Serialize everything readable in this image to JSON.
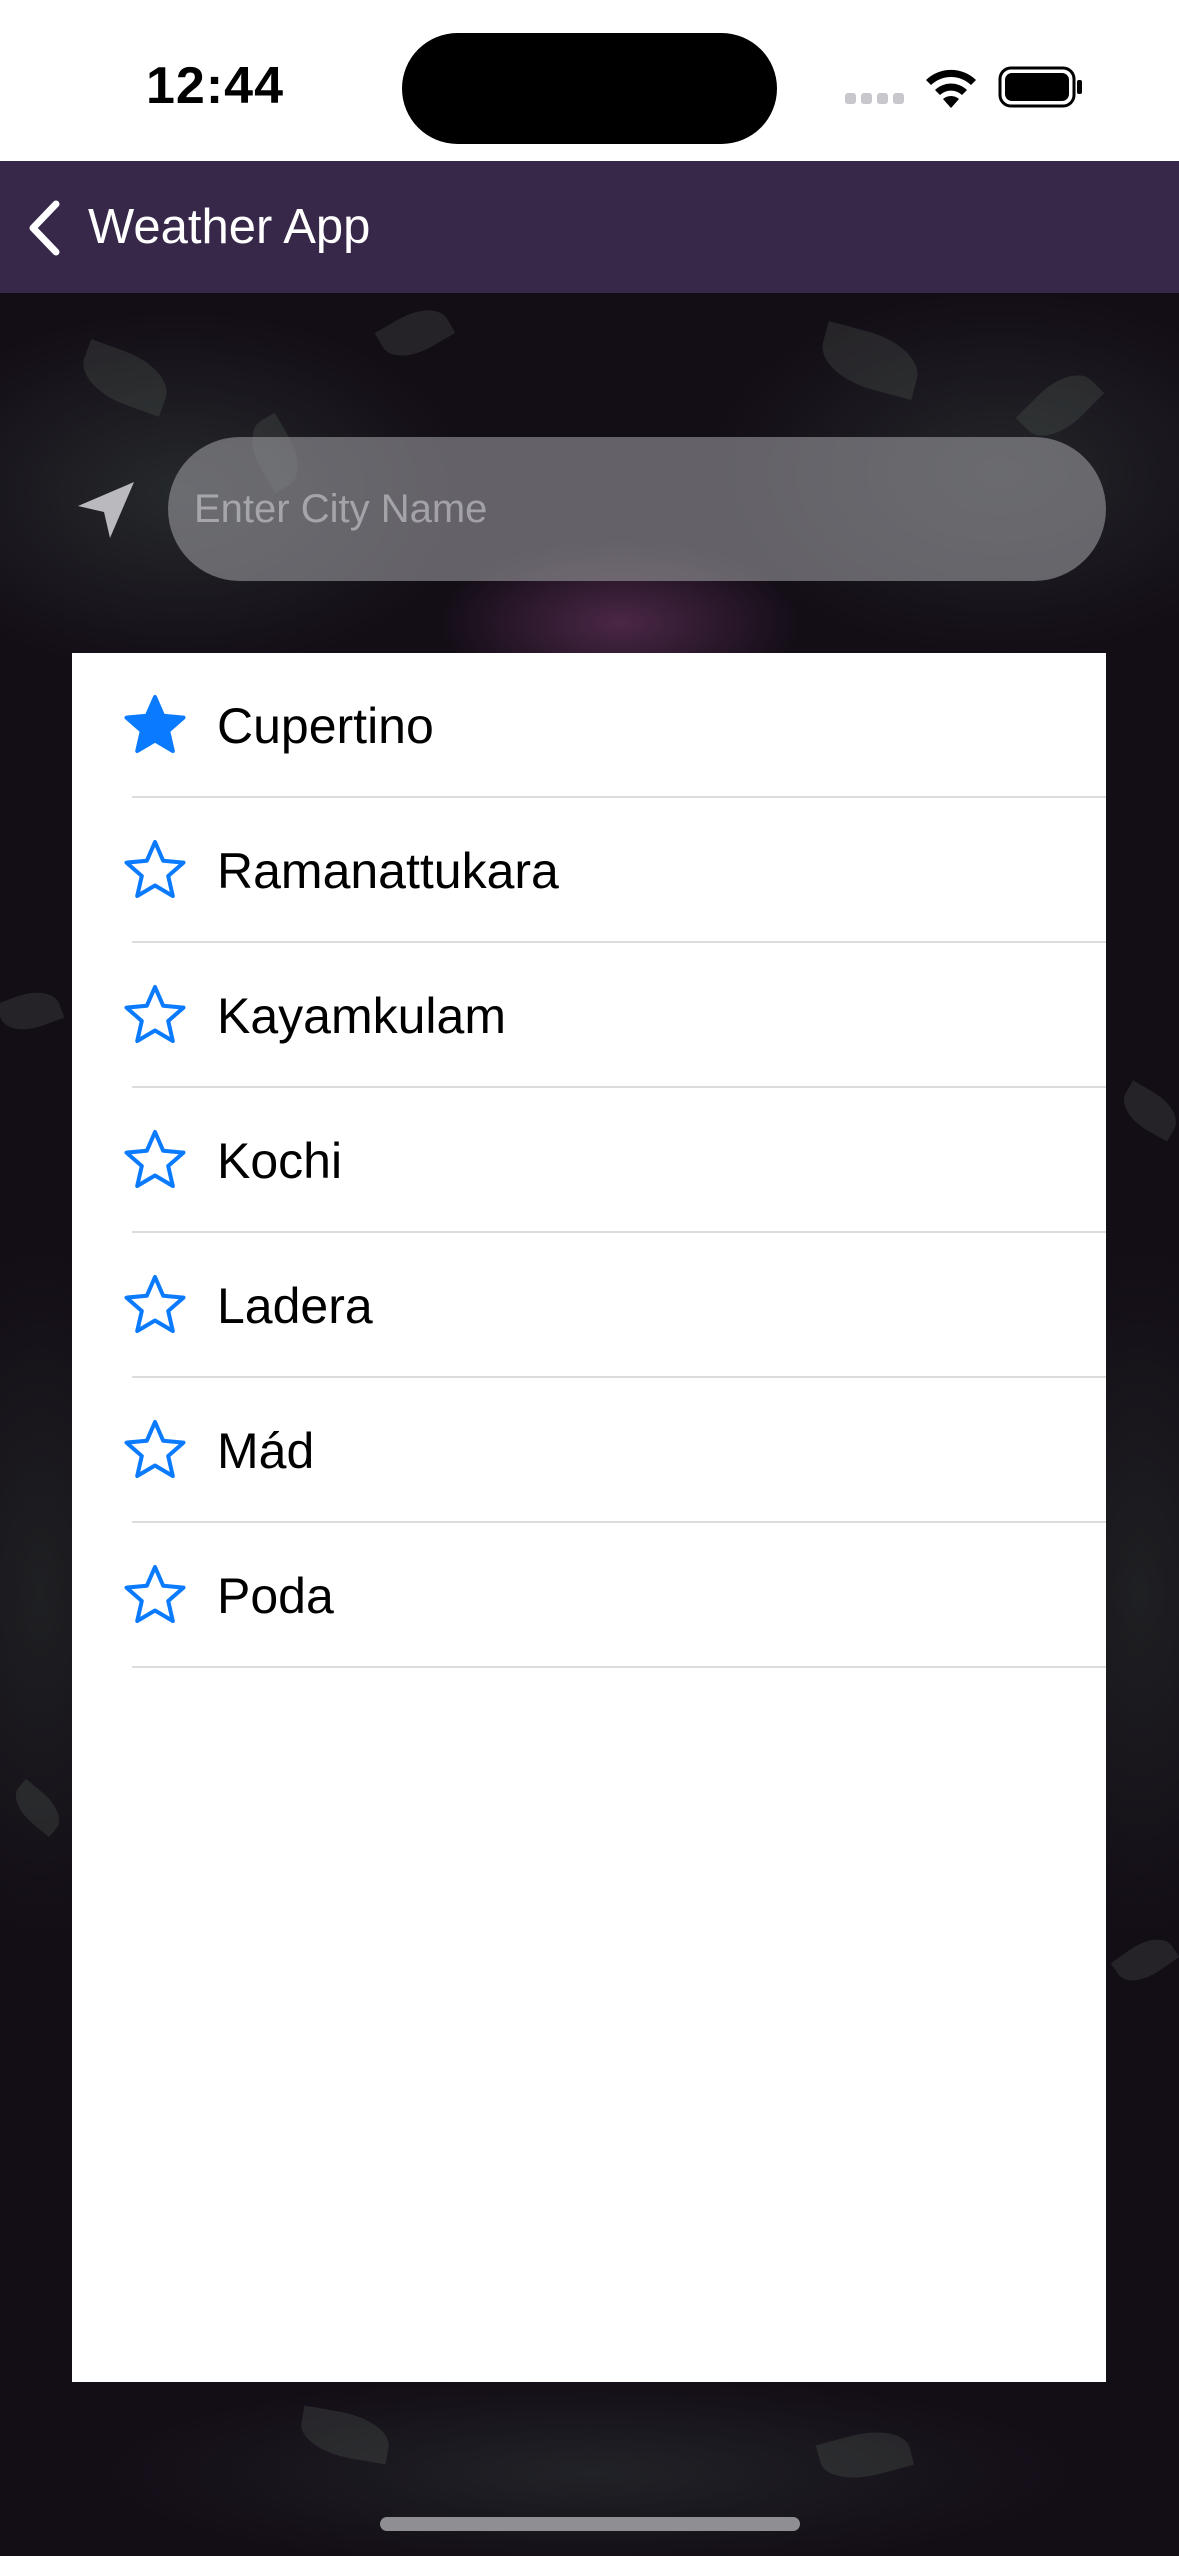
{
  "status_bar": {
    "time": "12:44",
    "icons": [
      "signal-icon",
      "wifi-icon",
      "battery-icon"
    ]
  },
  "nav": {
    "back_icon": "chevron-left-icon",
    "title": "Weather App"
  },
  "search": {
    "location_icon": "location-arrow-icon",
    "placeholder": "Enter City Name",
    "value": ""
  },
  "colors": {
    "nav_background": "#37284a",
    "accent": "#0a7aff",
    "input_background": "#96969b"
  },
  "cities": [
    {
      "name": "Cupertino",
      "favorite": true
    },
    {
      "name": "Ramanattukara",
      "favorite": false
    },
    {
      "name": "Kayamkulam",
      "favorite": false
    },
    {
      "name": "Kochi",
      "favorite": false
    },
    {
      "name": "Ladera",
      "favorite": false
    },
    {
      "name": "Mád",
      "favorite": false
    },
    {
      "name": "Poda",
      "favorite": false
    }
  ]
}
